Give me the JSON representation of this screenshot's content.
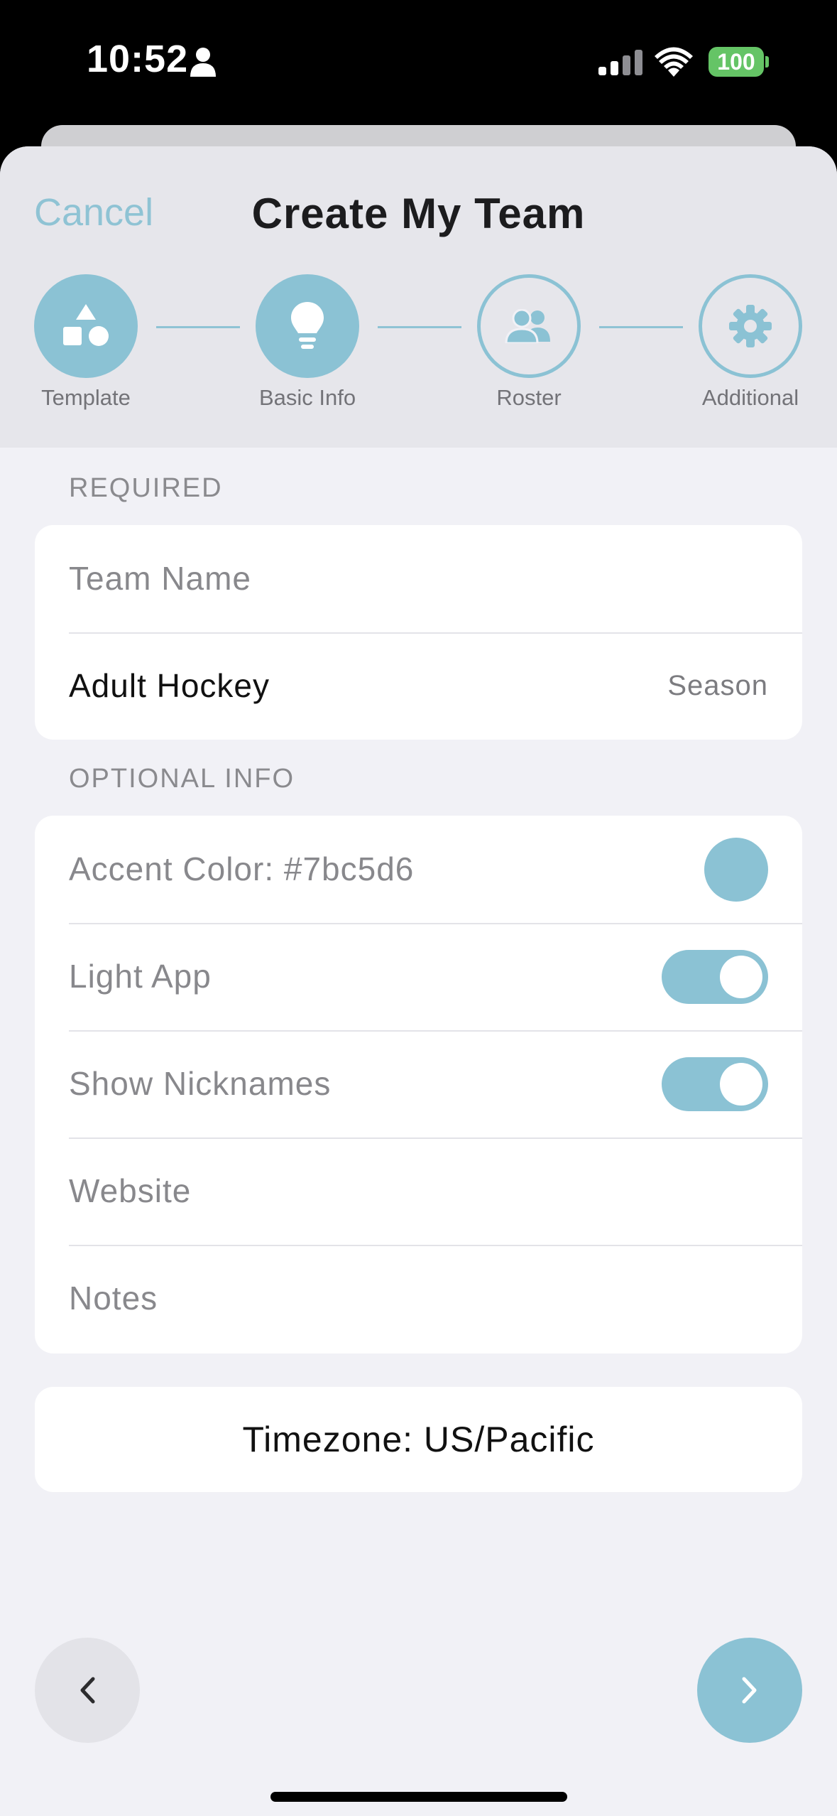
{
  "status_bar": {
    "time": "10:52",
    "battery": "100"
  },
  "header": {
    "cancel_label": "Cancel",
    "title": "Create My Team",
    "steps": [
      {
        "label": "Template",
        "icon": "shapes-icon",
        "state": "complete"
      },
      {
        "label": "Basic Info",
        "icon": "lightbulb-icon",
        "state": "current"
      },
      {
        "label": "Roster",
        "icon": "people-icon",
        "state": "upcoming"
      },
      {
        "label": "Additional",
        "icon": "gear-icon",
        "state": "upcoming"
      }
    ]
  },
  "required": {
    "section_label": "REQUIRED",
    "team_name_placeholder": "Team Name",
    "sport_value": "Adult Hockey",
    "sport_detail": "Season"
  },
  "optional": {
    "section_label": "OPTIONAL INFO",
    "accent_color_label": "Accent Color: #7bc5d6",
    "accent_color": "#8bc2d4",
    "light_app_label": "Light App",
    "light_app_on": true,
    "show_nicknames_label": "Show Nicknames",
    "show_nicknames_on": true,
    "website_placeholder": "Website",
    "notes_placeholder": "Notes"
  },
  "timezone_label": "Timezone: US/Pacific",
  "colors": {
    "accent": "#8bc2d4",
    "background": "#f1f1f6",
    "header": "#e6e6eb"
  }
}
